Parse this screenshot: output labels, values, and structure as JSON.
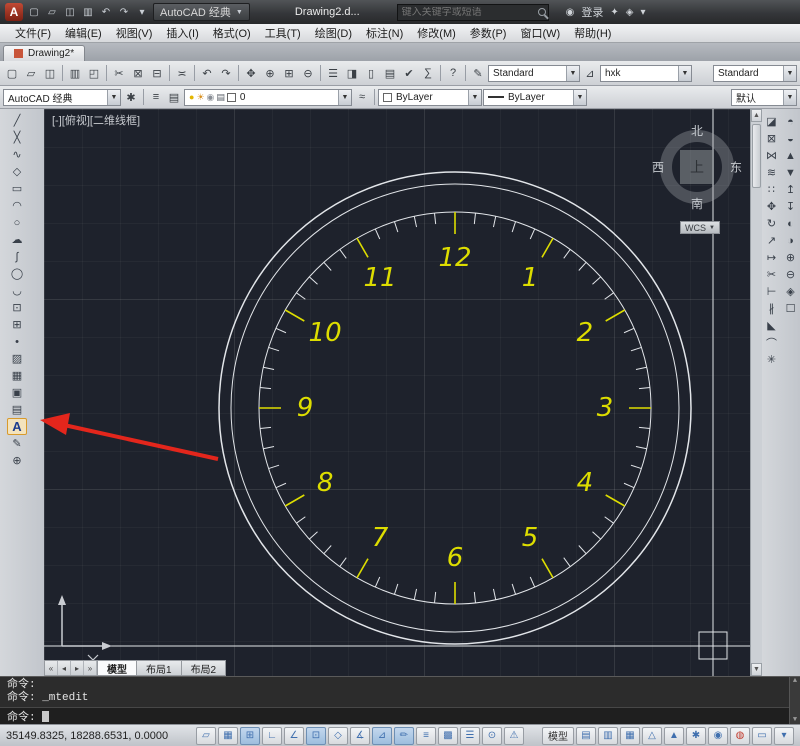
{
  "titlebar": {
    "logo": "A",
    "quick_access": [
      {
        "name": "new-file-icon",
        "glyph": "▢"
      },
      {
        "name": "open-file-icon",
        "glyph": "▱"
      },
      {
        "name": "save-icon",
        "glyph": "◫"
      },
      {
        "name": "plot-icon",
        "glyph": "▥"
      },
      {
        "name": "undo-icon",
        "glyph": "↶"
      },
      {
        "name": "redo-icon",
        "glyph": "↷"
      },
      {
        "name": "qat-dropdown-icon",
        "glyph": "▾"
      }
    ],
    "workspace_dropdown": "AutoCAD 经典",
    "doc_title": "Drawing2.d...",
    "search_placeholder": "键入关键字或短语",
    "signin_label": "登录",
    "right_icons": [
      {
        "name": "user-icon",
        "glyph": "◉"
      },
      {
        "name": "exchange-apps-icon",
        "glyph": "✦"
      },
      {
        "name": "stay-connected-icon",
        "glyph": "◈"
      },
      {
        "name": "help-menu-icon",
        "glyph": "▾"
      }
    ]
  },
  "menubar": {
    "items": [
      "文件(F)",
      "编辑(E)",
      "视图(V)",
      "插入(I)",
      "格式(O)",
      "工具(T)",
      "绘图(D)",
      "标注(N)",
      "修改(M)",
      "参数(P)",
      "窗口(W)",
      "帮助(H)"
    ]
  },
  "doc_tab": {
    "label": "Drawing2*"
  },
  "toolbar_top": {
    "icons": [
      {
        "name": "new-icon",
        "glyph": "▢"
      },
      {
        "name": "open-icon",
        "glyph": "▱"
      },
      {
        "name": "save-icon",
        "glyph": "◫"
      },
      {
        "name": "separator",
        "glyph": "|"
      },
      {
        "name": "plot-icon",
        "glyph": "▥"
      },
      {
        "name": "plot-preview-icon",
        "glyph": "◰"
      },
      {
        "name": "separator",
        "glyph": "|"
      },
      {
        "name": "cut-icon",
        "glyph": "✂"
      },
      {
        "name": "copy-icon",
        "glyph": "⊠"
      },
      {
        "name": "paste-icon",
        "glyph": "⊟"
      },
      {
        "name": "separator",
        "glyph": "|"
      },
      {
        "name": "match-properties-icon",
        "glyph": "≍"
      },
      {
        "name": "separator",
        "glyph": "|"
      },
      {
        "name": "undo-icon",
        "glyph": "↶"
      },
      {
        "name": "redo-icon",
        "glyph": "↷"
      },
      {
        "name": "separator",
        "glyph": "|"
      },
      {
        "name": "pan-icon",
        "glyph": "✥"
      },
      {
        "name": "zoom-realtime-icon",
        "glyph": "⊕"
      },
      {
        "name": "zoom-window-icon",
        "glyph": "⊞"
      },
      {
        "name": "zoom-previous-icon",
        "glyph": "⊖"
      },
      {
        "name": "separator",
        "glyph": "|"
      },
      {
        "name": "properties-icon",
        "glyph": "☰"
      },
      {
        "name": "designcenter-icon",
        "glyph": "◨"
      },
      {
        "name": "tool-palettes-icon",
        "glyph": "▯"
      },
      {
        "name": "sheetset-manager-icon",
        "glyph": "▤"
      },
      {
        "name": "markup-icon",
        "glyph": "✔"
      },
      {
        "name": "quickcalc-icon",
        "glyph": "∑"
      },
      {
        "name": "separator",
        "glyph": "|"
      },
      {
        "name": "help-icon",
        "glyph": "?"
      }
    ],
    "text_style_icon": "✎",
    "combos": [
      {
        "name": "text-style-combo",
        "value": "Standard"
      },
      {
        "name": "dim-style-combo",
        "value": "hxk"
      },
      {
        "name": "table-style-combo",
        "value": "Standard"
      }
    ]
  },
  "toolbar_second": {
    "workspace_value": "AutoCAD 经典",
    "workspace_gear_icon": "✱",
    "layer_icons": [
      {
        "name": "layer-properties-icon",
        "glyph": "≡"
      },
      {
        "name": "layer-states-icon",
        "glyph": "▤"
      }
    ],
    "layer_combo_icons": [
      {
        "name": "layer-on-icon",
        "glyph": "●",
        "color": "#e3b600"
      },
      {
        "name": "layer-freeze-icon",
        "glyph": "☀",
        "color": "#d89020"
      },
      {
        "name": "layer-lock-icon",
        "glyph": "◉",
        "color": "#8a8f96"
      },
      {
        "name": "layer-plot-icon",
        "glyph": "▤",
        "color": "#5a6068"
      }
    ],
    "layer_value": "0",
    "color_value": "ByLayer",
    "linetype_value": "ByLayer",
    "default_button": "默认"
  },
  "left_toolbar": {
    "icons": [
      {
        "name": "line-icon",
        "glyph": "╱"
      },
      {
        "name": "construction-line-icon",
        "glyph": "╳"
      },
      {
        "name": "polyline-icon",
        "glyph": "∿"
      },
      {
        "name": "polygon-icon",
        "glyph": "◇"
      },
      {
        "name": "rectangle-icon",
        "glyph": "▭"
      },
      {
        "name": "arc-icon",
        "glyph": "◠"
      },
      {
        "name": "circle-icon",
        "glyph": "○"
      },
      {
        "name": "revision-cloud-icon",
        "glyph": "☁"
      },
      {
        "name": "spline-icon",
        "glyph": "∫"
      },
      {
        "name": "ellipse-icon",
        "glyph": "◯"
      },
      {
        "name": "ellipse-arc-icon",
        "glyph": "◡"
      },
      {
        "name": "insert-block-icon",
        "glyph": "⊡"
      },
      {
        "name": "make-block-icon",
        "glyph": "⊞"
      },
      {
        "name": "point-icon",
        "glyph": "•"
      },
      {
        "name": "hatch-icon",
        "glyph": "▨"
      },
      {
        "name": "gradient-icon",
        "glyph": "▦"
      },
      {
        "name": "region-icon",
        "glyph": "▣"
      },
      {
        "name": "table-icon",
        "glyph": "▤"
      },
      {
        "name": "mtext-icon",
        "glyph": "A",
        "highlight": true
      },
      {
        "name": "edit-text-icon",
        "glyph": "✎"
      },
      {
        "name": "add-tool-icon",
        "glyph": "⊕"
      }
    ]
  },
  "right_toolbar_a": {
    "icons": [
      {
        "name": "erase-icon",
        "glyph": "◪"
      },
      {
        "name": "copy-icon",
        "glyph": "⊠"
      },
      {
        "name": "mirror-icon",
        "glyph": "⋈"
      },
      {
        "name": "offset-icon",
        "glyph": "≋"
      },
      {
        "name": "array-icon",
        "glyph": "∷"
      },
      {
        "name": "move-icon",
        "glyph": "✥"
      },
      {
        "name": "rotate-icon",
        "glyph": "↻"
      },
      {
        "name": "scale-icon",
        "glyph": "↗"
      },
      {
        "name": "stretch-icon",
        "glyph": "↦"
      },
      {
        "name": "trim-icon",
        "glyph": "✂"
      },
      {
        "name": "extend-icon",
        "glyph": "⊢"
      },
      {
        "name": "break-icon",
        "glyph": "∦"
      },
      {
        "name": "chamfer-icon",
        "glyph": "◣"
      },
      {
        "name": "fillet-icon",
        "glyph": "⌒"
      },
      {
        "name": "explode-icon",
        "glyph": "✳"
      }
    ]
  },
  "right_toolbar_b": {
    "icons": [
      {
        "name": "bring-to-front-icon",
        "glyph": "◓"
      },
      {
        "name": "send-to-back-icon",
        "glyph": "◒"
      },
      {
        "name": "bring-above-icon",
        "glyph": "▲"
      },
      {
        "name": "send-under-icon",
        "glyph": "▼"
      },
      {
        "name": "text-to-front-icon",
        "glyph": "↥"
      },
      {
        "name": "hatch-to-back-icon",
        "glyph": "↧"
      },
      {
        "name": "inspect-icon",
        "glyph": "◐"
      },
      {
        "name": "update-field-icon",
        "glyph": "◑"
      },
      {
        "name": "zoom-in-icon",
        "glyph": "⊕"
      },
      {
        "name": "zoom-out-icon",
        "glyph": "⊖"
      },
      {
        "name": "named-views-icon",
        "glyph": "◈"
      },
      {
        "name": "sheet-icon",
        "glyph": "☐"
      }
    ]
  },
  "canvas": {
    "viewport_label": "[-][俯视][二维线框]",
    "viewcube": {
      "north": "北",
      "south": "南",
      "west": "西",
      "east": "东",
      "top": "上",
      "wcs_label": "WCS"
    }
  },
  "clock": {
    "numbers": [
      "12",
      "1",
      "2",
      "3",
      "4",
      "5",
      "6",
      "7",
      "8",
      "9",
      "10",
      "11"
    ],
    "number_color": "#dddd00",
    "line_color": "#e2e5e9"
  },
  "layout_tabs": {
    "nav": [
      "«",
      "◂",
      "▸",
      "»"
    ],
    "items": [
      "模型",
      "布局1",
      "布局2"
    ],
    "active": "模型"
  },
  "command_panel": {
    "history": [
      "命令:",
      "命令: _mtedit"
    ],
    "prompt": "命令:"
  },
  "status_bar": {
    "coordinates": "35149.8325, 18288.6531, 0.0000",
    "toggles": [
      {
        "name": "infer-constraints-toggle",
        "glyph": "▱",
        "active": false
      },
      {
        "name": "snap-mode-toggle",
        "glyph": "▦",
        "active": false
      },
      {
        "name": "grid-display-toggle",
        "glyph": "⊞",
        "active": true
      },
      {
        "name": "ortho-mode-toggle",
        "glyph": "∟",
        "active": false
      },
      {
        "name": "polar-tracking-toggle",
        "glyph": "∠",
        "active": false
      },
      {
        "name": "object-snap-toggle",
        "glyph": "⊡",
        "active": true
      },
      {
        "name": "3d-object-snap-toggle",
        "glyph": "◇",
        "active": false
      },
      {
        "name": "object-snap-tracking-toggle",
        "glyph": "∡",
        "active": false
      },
      {
        "name": "dynamic-ucs-toggle",
        "glyph": "⊿",
        "active": true
      },
      {
        "name": "dynamic-input-toggle",
        "glyph": "✏",
        "active": true
      },
      {
        "name": "lineweight-toggle",
        "glyph": "≡",
        "active": false
      },
      {
        "name": "transparency-toggle",
        "glyph": "▩",
        "active": false
      },
      {
        "name": "quick-properties-toggle",
        "glyph": "☰",
        "active": false
      },
      {
        "name": "selection-cycling-toggle",
        "glyph": "⊙",
        "active": false
      },
      {
        "name": "annotation-monitor-toggle",
        "glyph": "⚠",
        "active": false
      }
    ],
    "model_button": "模型",
    "right_icons": [
      {
        "name": "layout-icon",
        "glyph": "▤"
      },
      {
        "name": "quick-view-layouts-icon",
        "glyph": "▥"
      },
      {
        "name": "quick-view-drawings-icon",
        "glyph": "▦"
      },
      {
        "name": "annotation-scale-icon",
        "glyph": "△"
      },
      {
        "name": "annotation-autoscale-icon",
        "glyph": "▲"
      },
      {
        "name": "workspace-switch-icon",
        "glyph": "✱"
      },
      {
        "name": "lock-ui-icon",
        "glyph": "◉"
      },
      {
        "name": "hardware-acceleration-icon",
        "glyph": "◍",
        "red": true
      },
      {
        "name": "cleanscreen-icon",
        "glyph": "▭"
      },
      {
        "name": "status-menu-icon",
        "glyph": "▾"
      }
    ]
  }
}
